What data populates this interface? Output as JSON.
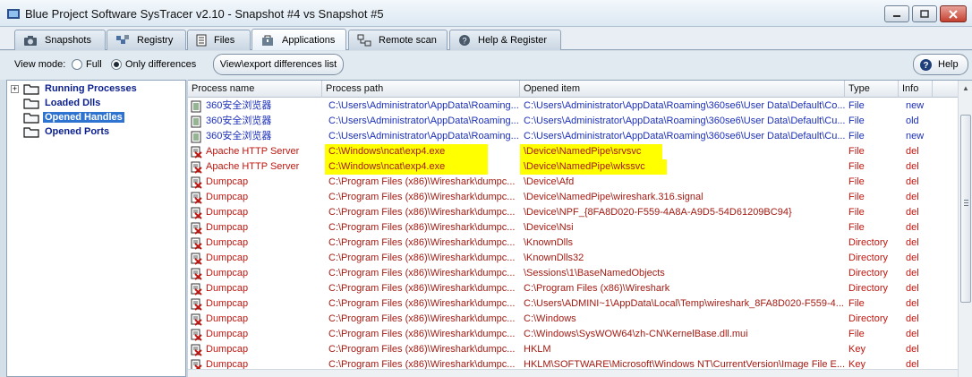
{
  "window": {
    "title": "Blue Project Software SysTracer v2.10 - Snapshot #4 vs Snapshot #5",
    "accent": "#2f73d0"
  },
  "tabs": [
    {
      "label": "Snapshots",
      "icon": "camera-icon"
    },
    {
      "label": "Registry",
      "icon": "registry-icon"
    },
    {
      "label": "Files",
      "icon": "files-icon"
    },
    {
      "label": "Applications",
      "icon": "applications-icon",
      "active": true
    },
    {
      "label": "Remote scan",
      "icon": "network-icon"
    },
    {
      "label": "Help & Register",
      "icon": "help-register-icon"
    }
  ],
  "toolbar": {
    "view_mode_label": "View mode:",
    "full_label": "Full",
    "only_diff_label": "Only differences",
    "selected_mode": "Only differences",
    "export_label": "View\\export differences list",
    "help_label": "Help"
  },
  "tree": [
    {
      "label": "Running Processes",
      "expandable": true
    },
    {
      "label": "Loaded Dlls"
    },
    {
      "label": "Opened Handles",
      "selected": true
    },
    {
      "label": "Opened Ports"
    }
  ],
  "grid": {
    "columns": [
      "Process name",
      "Process path",
      "Opened item",
      "Type",
      "Info"
    ],
    "rows": [
      {
        "process": "360安全浏览器",
        "path": "C:\\Users\\Administrator\\AppData\\Roaming...",
        "item": "C:\\Users\\Administrator\\AppData\\Roaming\\360se6\\User Data\\Default\\Co...",
        "type": "File",
        "info": "new",
        "status": "new"
      },
      {
        "process": "360安全浏览器",
        "path": "C:\\Users\\Administrator\\AppData\\Roaming...",
        "item": "C:\\Users\\Administrator\\AppData\\Roaming\\360se6\\User Data\\Default\\Cu...",
        "type": "File",
        "info": "old",
        "status": "old"
      },
      {
        "process": "360安全浏览器",
        "path": "C:\\Users\\Administrator\\AppData\\Roaming...",
        "item": "C:\\Users\\Administrator\\AppData\\Roaming\\360se6\\User Data\\Default\\Cu...",
        "type": "File",
        "info": "new",
        "status": "new"
      },
      {
        "process": "Apache HTTP Server",
        "path": "C:\\Windows\\ncat\\exp4.exe",
        "item": "\\Device\\NamedPipe\\srvsvc",
        "type": "File",
        "info": "del",
        "status": "del",
        "highlight": true
      },
      {
        "process": "Apache HTTP Server",
        "path": "C:\\Windows\\ncat\\exp4.exe",
        "item": "\\Device\\NamedPipe\\wkssvc",
        "type": "File",
        "info": "del",
        "status": "del",
        "highlight": true
      },
      {
        "process": "Dumpcap",
        "path": "C:\\Program Files (x86)\\Wireshark\\dumpc...",
        "item": "\\Device\\Afd",
        "type": "File",
        "info": "del",
        "status": "del"
      },
      {
        "process": "Dumpcap",
        "path": "C:\\Program Files (x86)\\Wireshark\\dumpc...",
        "item": "\\Device\\NamedPipe\\wireshark.316.signal",
        "type": "File",
        "info": "del",
        "status": "del"
      },
      {
        "process": "Dumpcap",
        "path": "C:\\Program Files (x86)\\Wireshark\\dumpc...",
        "item": "\\Device\\NPF_{8FA8D020-F559-4A8A-A9D5-54D61209BC94}",
        "type": "File",
        "info": "del",
        "status": "del"
      },
      {
        "process": "Dumpcap",
        "path": "C:\\Program Files (x86)\\Wireshark\\dumpc...",
        "item": "\\Device\\Nsi",
        "type": "File",
        "info": "del",
        "status": "del"
      },
      {
        "process": "Dumpcap",
        "path": "C:\\Program Files (x86)\\Wireshark\\dumpc...",
        "item": "\\KnownDlls",
        "type": "Directory",
        "info": "del",
        "status": "del"
      },
      {
        "process": "Dumpcap",
        "path": "C:\\Program Files (x86)\\Wireshark\\dumpc...",
        "item": "\\KnownDlls32",
        "type": "Directory",
        "info": "del",
        "status": "del"
      },
      {
        "process": "Dumpcap",
        "path": "C:\\Program Files (x86)\\Wireshark\\dumpc...",
        "item": "\\Sessions\\1\\BaseNamedObjects",
        "type": "Directory",
        "info": "del",
        "status": "del"
      },
      {
        "process": "Dumpcap",
        "path": "C:\\Program Files (x86)\\Wireshark\\dumpc...",
        "item": "C:\\Program Files (x86)\\Wireshark",
        "type": "Directory",
        "info": "del",
        "status": "del"
      },
      {
        "process": "Dumpcap",
        "path": "C:\\Program Files (x86)\\Wireshark\\dumpc...",
        "item": "C:\\Users\\ADMINI~1\\AppData\\Local\\Temp\\wireshark_8FA8D020-F559-4...",
        "type": "File",
        "info": "del",
        "status": "del"
      },
      {
        "process": "Dumpcap",
        "path": "C:\\Program Files (x86)\\Wireshark\\dumpc...",
        "item": "C:\\Windows",
        "type": "Directory",
        "info": "del",
        "status": "del"
      },
      {
        "process": "Dumpcap",
        "path": "C:\\Program Files (x86)\\Wireshark\\dumpc...",
        "item": "C:\\Windows\\SysWOW64\\zh-CN\\KernelBase.dll.mui",
        "type": "File",
        "info": "del",
        "status": "del"
      },
      {
        "process": "Dumpcap",
        "path": "C:\\Program Files (x86)\\Wireshark\\dumpc...",
        "item": "HKLM",
        "type": "Key",
        "info": "del",
        "status": "del"
      },
      {
        "process": "Dumpcap",
        "path": "C:\\Program Files (x86)\\Wireshark\\dumpc...",
        "item": "HKLM\\SOFTWARE\\Microsoft\\Windows NT\\CurrentVersion\\Image File E...",
        "type": "Key",
        "info": "del",
        "status": "del"
      }
    ]
  }
}
